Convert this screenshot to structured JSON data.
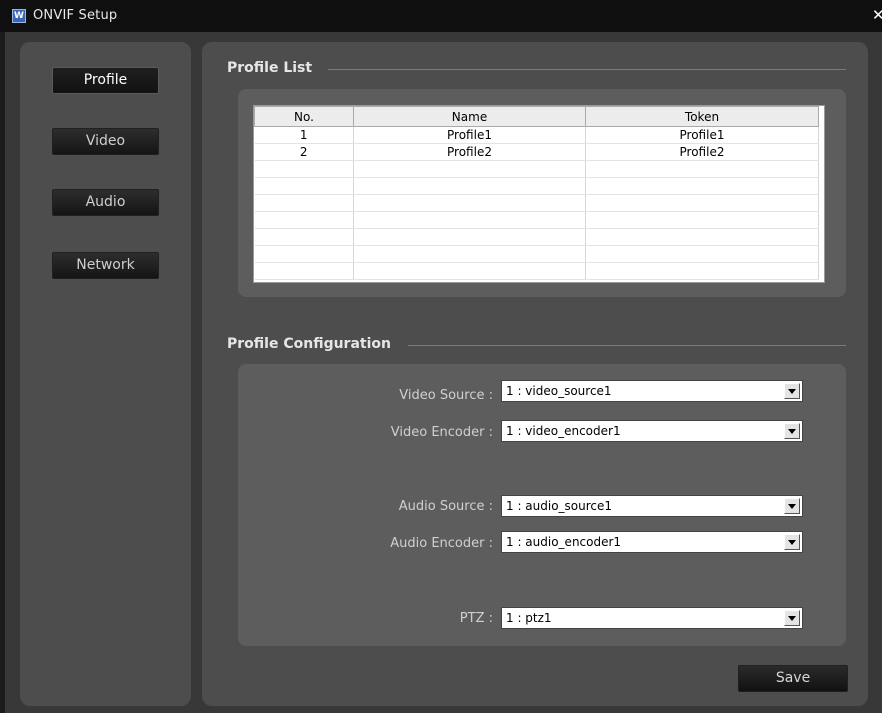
{
  "window": {
    "title": "ONVIF Setup",
    "close_glyph": "✕",
    "app_icon": "app-logo-icon",
    "app_icon_text": "W"
  },
  "sidebar": {
    "items": [
      {
        "label": "Profile",
        "active": true
      },
      {
        "label": "Video",
        "active": false
      },
      {
        "label": "Audio",
        "active": false
      },
      {
        "label": "Network",
        "active": false
      }
    ]
  },
  "profile_list": {
    "heading": "Profile List",
    "columns": [
      "No.",
      "Name",
      "Token"
    ],
    "rows": [
      [
        "1",
        "Profile1",
        "Profile1"
      ],
      [
        "2",
        "Profile2",
        "Profile2"
      ],
      [
        "",
        "",
        ""
      ],
      [
        "",
        "",
        ""
      ],
      [
        "",
        "",
        ""
      ],
      [
        "",
        "",
        ""
      ],
      [
        "",
        "",
        ""
      ],
      [
        "",
        "",
        ""
      ],
      [
        "",
        "",
        ""
      ]
    ]
  },
  "profile_config": {
    "heading": "Profile Configuration",
    "video_source": {
      "label": "Video Source :",
      "value": "1 : video_source1"
    },
    "video_encoder": {
      "label": "Video Encoder :",
      "value": "1 : video_encoder1"
    },
    "audio_source": {
      "label": "Audio Source :",
      "value": "1 : audio_source1"
    },
    "audio_encoder": {
      "label": "Audio Encoder :",
      "value": "1 : audio_encoder1"
    },
    "ptz": {
      "label": "PTZ :",
      "value": "1 : ptz1"
    }
  },
  "actions": {
    "save_label": "Save"
  }
}
